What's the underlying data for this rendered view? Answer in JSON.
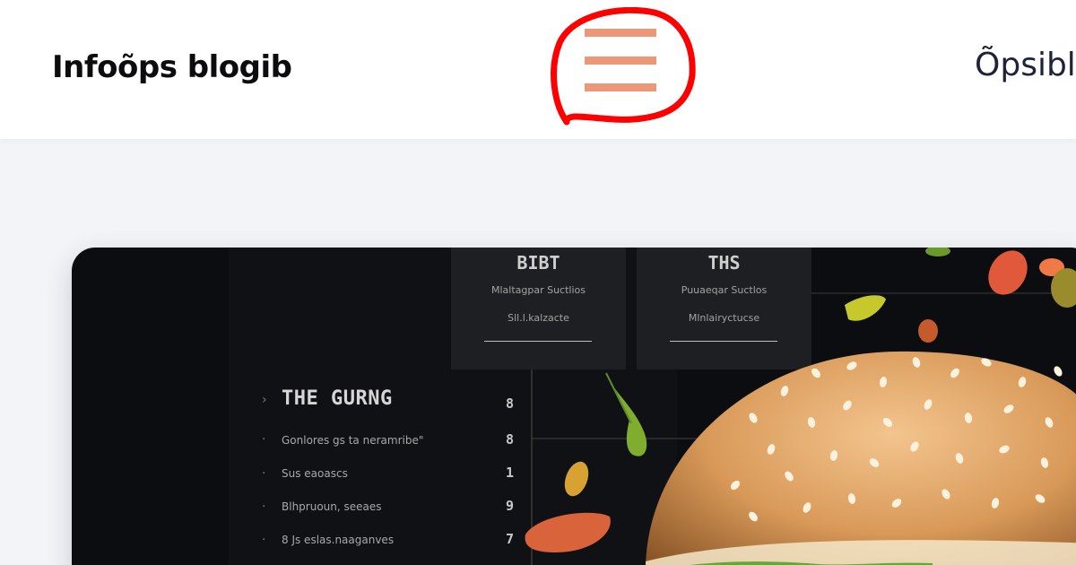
{
  "header": {
    "brand": "Infoõps blogib",
    "nav_link": "Õpsibl",
    "menu_icon": "hamburger-menu-icon",
    "annotation_color": "#ff0000",
    "menu_icon_color": "#ec9876"
  },
  "hero": {
    "image": "burger-menu-board",
    "box1": {
      "title": "BIBT",
      "line1": "Mlaltagpar Suctlios",
      "line2": "Sll.l.kalzacte"
    },
    "box2": {
      "title": "THS",
      "line1": "Puuaeqar Suctlos",
      "line2": "Mlnlairyctucse"
    },
    "list": {
      "heading": "THE GURNG",
      "items": [
        {
          "label": "Gonlores gs ta neramribe\"",
          "value": "8"
        },
        {
          "label": "Sus eaoascs",
          "value": "1"
        },
        {
          "label": "Blhpruoun, seeaes",
          "value": "9"
        },
        {
          "label": "8 Js eslas.naaganves",
          "value": "7"
        }
      ],
      "top_value": "8"
    }
  }
}
